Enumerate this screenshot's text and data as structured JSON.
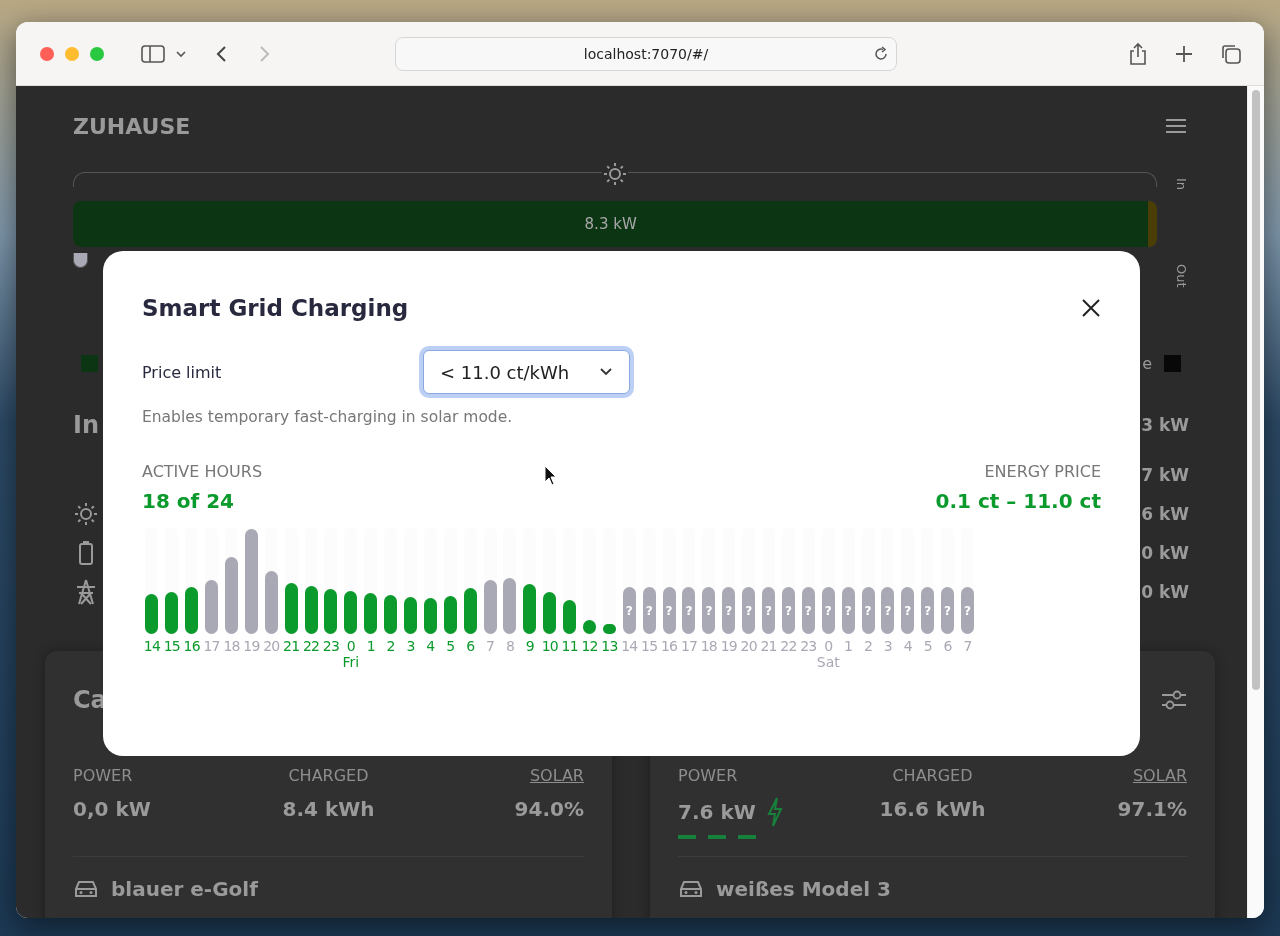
{
  "browser": {
    "url": "localhost:7070/#/"
  },
  "page": {
    "title": "ZUHAUSE",
    "flow": {
      "in_label": "In",
      "out_label": "Out",
      "value": "8.3 kW",
      "level": 0.992
    },
    "legend": {
      "end_text": "e"
    },
    "section_title": "In",
    "section_value": "3 kW",
    "rows": [
      {
        "kind": "plain",
        "value": "7 kW"
      },
      {
        "kind": "solar",
        "value": "6 kW"
      },
      {
        "kind": "battery",
        "value": "0 kW"
      },
      {
        "kind": "grid",
        "value": "0 kW"
      }
    ],
    "cards": [
      {
        "title": "Ca",
        "charging": false,
        "metrics": [
          {
            "kind": "plain",
            "label": "POWER",
            "value": "0,0 kW"
          },
          {
            "kind": "plain",
            "label": "CHARGED",
            "value": "8.4 kWh"
          },
          {
            "kind": "link",
            "label": "SOLAR",
            "value": "94.0%"
          }
        ],
        "vehicle": "blauer e-Golf"
      },
      {
        "charging": true,
        "settings": true,
        "metrics": [
          {
            "kind": "plain",
            "label": "POWER",
            "value": "7.6 kW"
          },
          {
            "kind": "plain",
            "label": "CHARGED",
            "value": "16.6 kWh"
          },
          {
            "kind": "link",
            "label": "SOLAR",
            "value": "97.1%"
          }
        ],
        "vehicle": "weißes Model 3"
      }
    ]
  },
  "modal": {
    "title": "Smart Grid Charging",
    "field_label": "Price limit",
    "select_value": "< 11.0 ct/kWh",
    "hint": "Enables temporary fast-charging in solar mode.",
    "active_hours": {
      "label": "ACTIVE HOURS",
      "value": "18 of 24"
    },
    "energy_price": {
      "label": "ENERGY PRICE",
      "value": "0.1 ct – 11.0 ct"
    },
    "slots": [
      {
        "kind": "known",
        "hour": "14",
        "active": true,
        "level": 0.38
      },
      {
        "kind": "known",
        "hour": "15",
        "active": true,
        "level": 0.4
      },
      {
        "kind": "known",
        "hour": "16",
        "active": true,
        "level": 0.45
      },
      {
        "kind": "known",
        "hour": "17",
        "active": false,
        "level": 0.51
      },
      {
        "kind": "known",
        "hour": "18",
        "active": false,
        "level": 0.73
      },
      {
        "kind": "known",
        "hour": "19",
        "active": false,
        "level": 1
      },
      {
        "kind": "known",
        "hour": "20",
        "active": false,
        "level": 0.6
      },
      {
        "kind": "known",
        "hour": "21",
        "active": true,
        "level": 0.49
      },
      {
        "kind": "known",
        "hour": "22",
        "active": true,
        "level": 0.46
      },
      {
        "kind": "known",
        "hour": "23",
        "active": true,
        "level": 0.43
      },
      {
        "kind": "known",
        "hour": "0",
        "active": true,
        "level": 0.41,
        "day": "Fri"
      },
      {
        "kind": "known",
        "hour": "1",
        "active": true,
        "level": 0.39
      },
      {
        "kind": "known",
        "hour": "2",
        "active": true,
        "level": 0.37
      },
      {
        "kind": "known",
        "hour": "3",
        "active": true,
        "level": 0.35
      },
      {
        "kind": "known",
        "hour": "4",
        "active": true,
        "level": 0.34
      },
      {
        "kind": "known",
        "hour": "5",
        "active": true,
        "level": 0.36
      },
      {
        "kind": "known",
        "hour": "6",
        "active": true,
        "level": 0.44
      },
      {
        "kind": "known",
        "hour": "7",
        "active": false,
        "level": 0.51
      },
      {
        "kind": "known",
        "hour": "8",
        "active": false,
        "level": 0.53
      },
      {
        "kind": "known",
        "hour": "9",
        "active": true,
        "level": 0.48
      },
      {
        "kind": "known",
        "hour": "10",
        "active": true,
        "level": 0.4
      },
      {
        "kind": "known",
        "hour": "11",
        "active": true,
        "level": 0.32
      },
      {
        "kind": "known",
        "hour": "12",
        "active": true,
        "level": 0.13
      },
      {
        "kind": "known",
        "hour": "13",
        "active": true,
        "level": 0.1
      },
      {
        "kind": "unknown",
        "hour": "14",
        "active": false,
        "mark": "?"
      },
      {
        "kind": "unknown",
        "hour": "15",
        "active": false,
        "mark": "?"
      },
      {
        "kind": "unknown",
        "hour": "16",
        "active": false,
        "mark": "?"
      },
      {
        "kind": "unknown",
        "hour": "17",
        "active": false,
        "mark": "?"
      },
      {
        "kind": "unknown",
        "hour": "18",
        "active": false,
        "mark": "?"
      },
      {
        "kind": "unknown",
        "hour": "19",
        "active": false,
        "mark": "?"
      },
      {
        "kind": "unknown",
        "hour": "20",
        "active": false,
        "mark": "?"
      },
      {
        "kind": "unknown",
        "hour": "21",
        "active": false,
        "mark": "?"
      },
      {
        "kind": "unknown",
        "hour": "22",
        "active": false,
        "mark": "?"
      },
      {
        "kind": "unknown",
        "hour": "23",
        "active": false,
        "mark": "?"
      },
      {
        "kind": "unknown",
        "hour": "0",
        "active": false,
        "mark": "?",
        "day": "Sat"
      },
      {
        "kind": "unknown",
        "hour": "1",
        "active": false,
        "mark": "?"
      },
      {
        "kind": "unknown",
        "hour": "2",
        "active": false,
        "mark": "?"
      },
      {
        "kind": "unknown",
        "hour": "3",
        "active": false,
        "mark": "?"
      },
      {
        "kind": "unknown",
        "hour": "4",
        "active": false,
        "mark": "?"
      },
      {
        "kind": "unknown",
        "hour": "5",
        "active": false,
        "mark": "?"
      },
      {
        "kind": "unknown",
        "hour": "6",
        "active": false,
        "mark": "?"
      },
      {
        "kind": "unknown",
        "hour": "7",
        "active": false,
        "mark": "?"
      }
    ]
  }
}
